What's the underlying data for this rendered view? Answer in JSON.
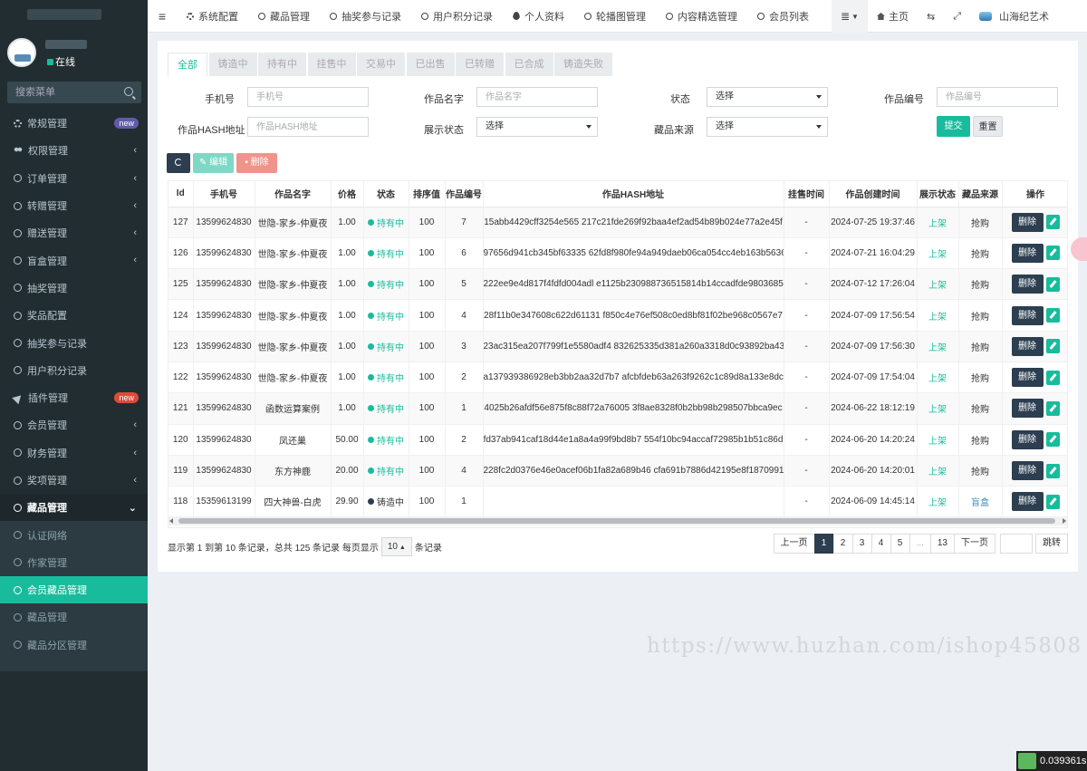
{
  "sidebar": {
    "status": "在线",
    "search_placeholder": "搜索菜单",
    "items": [
      {
        "label": "常规管理",
        "badge": "new"
      },
      {
        "label": "权限管理"
      },
      {
        "label": "订单管理"
      },
      {
        "label": "转赠管理"
      },
      {
        "label": "赠送管理"
      },
      {
        "label": "盲盒管理"
      },
      {
        "label": "抽奖管理"
      },
      {
        "label": "奖品配置"
      },
      {
        "label": "抽奖参与记录"
      },
      {
        "label": "用户积分记录"
      },
      {
        "label": "插件管理",
        "badge": "new"
      },
      {
        "label": "会员管理"
      },
      {
        "label": "财务管理"
      },
      {
        "label": "奖项管理"
      },
      {
        "label": "藏品管理"
      },
      {
        "label": "认证网络"
      },
      {
        "label": "作家管理"
      },
      {
        "label": "会员藏品管理"
      },
      {
        "label": "藏品管理"
      },
      {
        "label": "藏品分区管理"
      }
    ]
  },
  "header": {
    "tabs": [
      "系统配置",
      "藏品管理",
      "抽奖参与记录",
      "用户积分记录",
      "个人资料",
      "轮播图管理",
      "内容精选管理",
      "会员列表"
    ],
    "home": "主页",
    "site_name": "山海纪艺术"
  },
  "filters": {
    "status_tabs": [
      "全部",
      "铸造中",
      "持有中",
      "挂售中",
      "交易中",
      "已出售",
      "已转赠",
      "已合成",
      "铸造失败"
    ],
    "phone_label": "手机号",
    "phone_placeholder": "手机号",
    "name_label": "作品名字",
    "name_placeholder": "作品名字",
    "state_label": "状态",
    "state_value": "选择",
    "code_label": "作品编号",
    "code_placeholder": "作品编号",
    "hash_label": "作品HASH地址",
    "hash_placeholder": "作品HASH地址",
    "display_label": "展示状态",
    "display_value": "选择",
    "source_label": "藏品来源",
    "source_value": "选择",
    "submit": "提交",
    "reset": "重置"
  },
  "toolbar": {
    "edit": "编辑",
    "delete": "删除"
  },
  "table": {
    "columns": [
      "Id",
      "手机号",
      "作品名字",
      "价格",
      "状态",
      "排序值",
      "作品编号",
      "作品HASH地址",
      "挂售时间",
      "作品创建时间",
      "展示状态",
      "藏品来源",
      "操作"
    ],
    "delete_label": "删除",
    "rows": [
      [
        "127",
        "13599624830",
        "世隐-家乡-仲夏夜",
        "1.00",
        "持有中",
        "100",
        "7",
        "15abb4429cff3254e565 217c21fde269f92baa4ef2ad54b89b024e77a2e45f",
        "-",
        "2024-07-25 19:37:46",
        "上架",
        "抢购"
      ],
      [
        "126",
        "13599624830",
        "世隐-家乡-仲夏夜",
        "1.00",
        "持有中",
        "100",
        "6",
        "97656d941cb345bf63335 62fd8f980fe94a949daeb06ca054cc4eb163b5636",
        "-",
        "2024-07-21 16:04:29",
        "上架",
        "抢购"
      ],
      [
        "125",
        "13599624830",
        "世隐-家乡-仲夏夜",
        "1.00",
        "持有中",
        "100",
        "5",
        "222ee9e4d817f4fdfd004adl e1125b230988736515814b14ccadfde9803685d",
        "-",
        "2024-07-12 17:26:04",
        "上架",
        "抢购"
      ],
      [
        "124",
        "13599624830",
        "世隐-家乡-仲夏夜",
        "1.00",
        "持有中",
        "100",
        "4",
        "28f11b0e347608c622d61131 f850c4e76ef508c0ed8bf81f02be968c0567e7",
        "-",
        "2024-07-09 17:56:54",
        "上架",
        "抢购"
      ],
      [
        "123",
        "13599624830",
        "世隐-家乡-仲夏夜",
        "1.00",
        "持有中",
        "100",
        "3",
        "23ac315ea207f799f1e5580adf4 832625335d381a260a3318d0c93892ba43b",
        "-",
        "2024-07-09 17:56:30",
        "上架",
        "抢购"
      ],
      [
        "122",
        "13599624830",
        "世隐-家乡-仲夏夜",
        "1.00",
        "持有中",
        "100",
        "2",
        "a137939386928eb3bb2aa32d7b7 afcbfdeb63a263f9262c1c89d8a133e8dcf",
        "-",
        "2024-07-09 17:54:04",
        "上架",
        "抢购"
      ],
      [
        "121",
        "13599624830",
        "函数运算案例",
        "1.00",
        "持有中",
        "100",
        "1",
        "4025b26afdf56e875f8c88f72a76005 3f8ae8328f0b2bb98b298507bbca9ec",
        "-",
        "2024-06-22 18:12:19",
        "上架",
        "抢购"
      ],
      [
        "120",
        "13599624830",
        "凤还巢",
        "50.00",
        "持有中",
        "100",
        "2",
        "fd37ab941caf18d44e1a8a4a99f9bd8b7 554f10bc94accaf72985b1b51c86d",
        "-",
        "2024-06-20 14:20:24",
        "上架",
        "抢购"
      ],
      [
        "119",
        "13599624830",
        "东方神鹿",
        "20.00",
        "持有中",
        "100",
        "4",
        "228fc2d0376e46e0acef06b1fa82a689b46 cfa691b7886d42195e8f1870991",
        "-",
        "2024-06-20 14:20:01",
        "上架",
        "抢购"
      ],
      [
        "118",
        "15359613199",
        "四大神兽-白虎",
        "29.90",
        "铸造中",
        "100",
        "1",
        "",
        "-",
        "2024-06-09 14:45:14",
        "上架",
        "盲盒"
      ]
    ]
  },
  "pagination": {
    "info_prefix": "显示第 1 到第 10 条记录，总共 125 条记录 每页显示",
    "page_size": "10",
    "info_suffix": "条记录",
    "prev": "上一页",
    "pages": [
      "1",
      "2",
      "3",
      "4",
      "5",
      "...",
      "13"
    ],
    "next": "下一页",
    "jump": "跳转"
  },
  "watermark": "https://www.huzhan.com/ishop45808",
  "timer": "0.039361s"
}
